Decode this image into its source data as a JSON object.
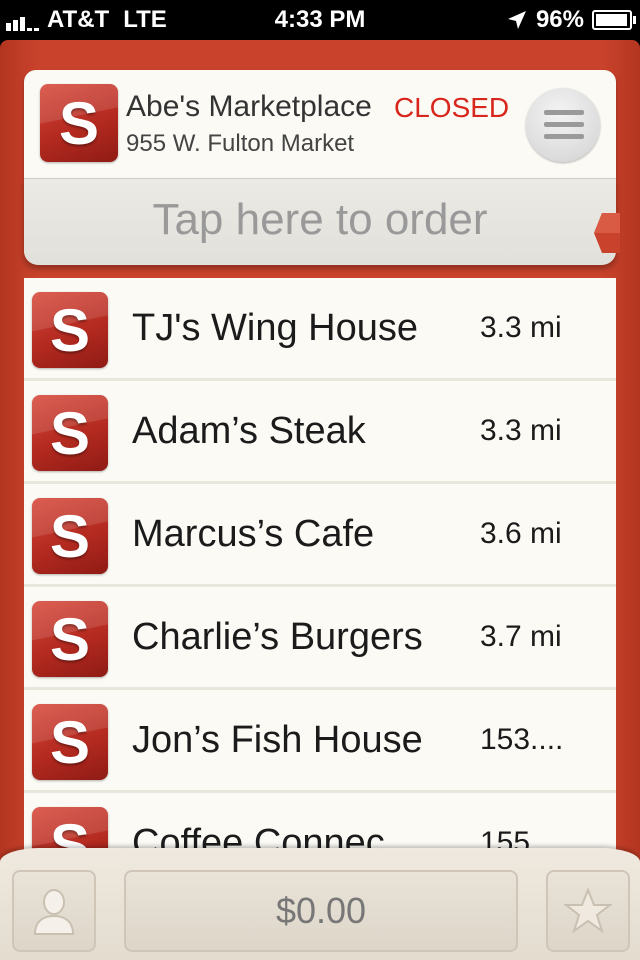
{
  "status_bar": {
    "carrier": "AT&T",
    "network": "LTE",
    "time": "4:33 PM",
    "battery": "96%",
    "battery_level": 0.96
  },
  "store": {
    "logo_letter": "S",
    "name": "Abe's Marketplace",
    "status": "CLOSED",
    "address": "955 W. Fulton Market"
  },
  "order_bar": {
    "label": "Tap here to order"
  },
  "restaurants": [
    {
      "name": "TJ's Wing House",
      "distance": "3.3 mi",
      "logo_letter": "S"
    },
    {
      "name": "Adam’s Steak",
      "distance": "3.3 mi",
      "logo_letter": "S"
    },
    {
      "name": "Marcus’s Cafe",
      "distance": "3.6 mi",
      "logo_letter": "S"
    },
    {
      "name": "Charlie’s Burgers",
      "distance": "3.7 mi",
      "logo_letter": "S"
    },
    {
      "name": "Jon’s Fish House",
      "distance": "153....",
      "logo_letter": "S"
    },
    {
      "name": "Coffee Connec",
      "distance": "155",
      "logo_letter": "S"
    }
  ],
  "bottom_bar": {
    "cart_total": "$0.00",
    "profile_icon": "person-icon",
    "favorite_icon": "star-icon"
  },
  "colors": {
    "brand_red": "#c9432c",
    "closed_red": "#d9261c",
    "list_bg": "#fbfaf5"
  }
}
